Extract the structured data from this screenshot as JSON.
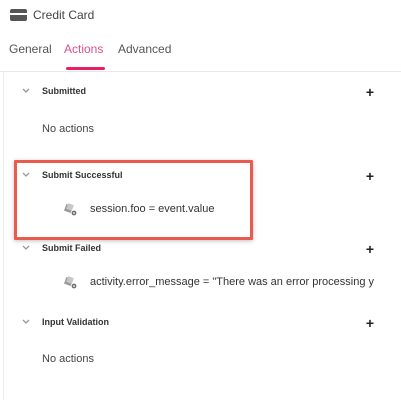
{
  "header": {
    "title": "Credit Card",
    "icon": "credit-card-icon"
  },
  "tabs": [
    {
      "label": "General",
      "active": false
    },
    {
      "label": "Actions",
      "active": true
    },
    {
      "label": "Advanced",
      "active": false
    }
  ],
  "accent_color": "#e91e63",
  "highlight_color": "#ea5b4f",
  "sections": [
    {
      "title": "Submitted",
      "empty_text": "No actions"
    },
    {
      "title": "Submit Successful",
      "action": "session.foo = event.value"
    },
    {
      "title": "Submit Failed",
      "action": "activity.error_message = \"There was an error processing your payment\""
    },
    {
      "title": "Input Validation",
      "empty_text": "No actions"
    }
  ],
  "add_label": "+"
}
